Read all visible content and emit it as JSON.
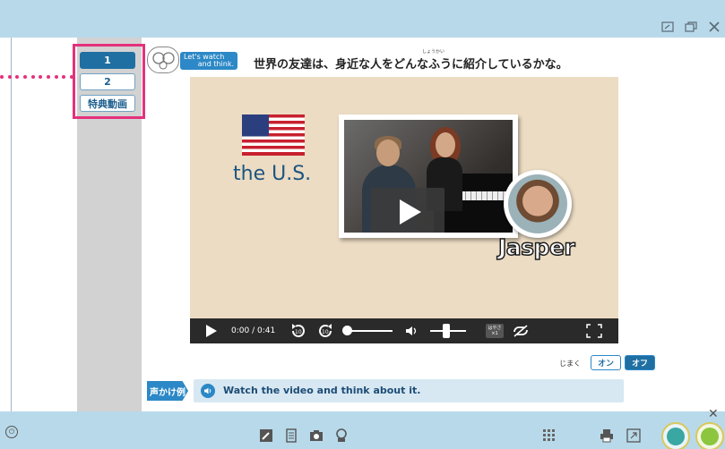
{
  "page_nav": {
    "items": [
      {
        "label": "1",
        "active": true
      },
      {
        "label": "2",
        "active": false
      },
      {
        "label": "特典動画",
        "active": false
      }
    ]
  },
  "header": {
    "badge_line1": "Let's watch",
    "badge_line2": "and think.",
    "instruction": "世界の友達は、身近な人をどんなふうに紹介しているかな。",
    "ruby": "しょうかい"
  },
  "video": {
    "country_label": "the U.S.",
    "person_name": "Jasper",
    "time_display": "0:00 / 0:41",
    "speed_label_1": "はやさ",
    "speed_label_2": "×1"
  },
  "subtitles": {
    "label": "じまく",
    "on_label": "オン",
    "off_label": "オフ",
    "selected": "オフ"
  },
  "voice_prompt": {
    "badge": "声かけ例",
    "text": "Watch the video and think about it."
  },
  "colors": {
    "accent": "#2c88c6",
    "highlight": "#e4317d",
    "frame": "#b8d9ea"
  }
}
